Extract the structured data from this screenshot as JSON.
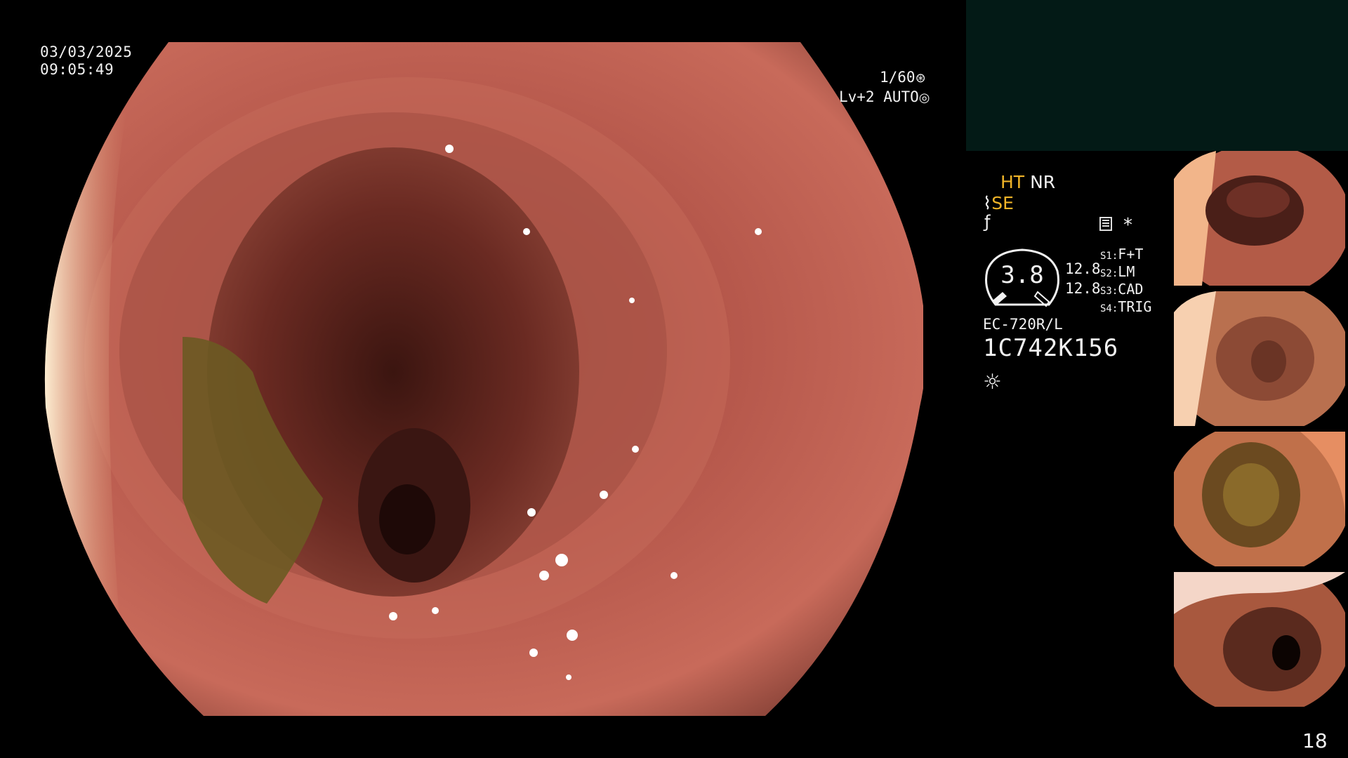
{
  "overlay": {
    "date": "03/03/2025",
    "time": "09:05:49",
    "shutter": "1/60",
    "shutter_icon": "aperture-icon",
    "level": "Lv+2 AUTO",
    "level_icon": "auto-iris-icon"
  },
  "panel": {
    "ht": "HT",
    "nr": "NR",
    "se": "SE",
    "se_icon": "scope-mode-icon",
    "f_icon": "freeze-icon",
    "grid_icon": "memory-icon",
    "star": "*",
    "gauge_value": "3.8",
    "zoom_top": "12.8",
    "zoom_bottom": "12.8",
    "switches": [
      {
        "key": "S1:",
        "value": "F+T"
      },
      {
        "key": "S2:",
        "value": "LM"
      },
      {
        "key": "S3:",
        "value": "CAD"
      },
      {
        "key": "S4:",
        "value": "TRIG"
      }
    ],
    "model": "EC-720R/L",
    "serial": "1C742K156",
    "light_icon": "sun-icon"
  },
  "thumbnails": [
    {
      "label": "thumbnail-1"
    },
    {
      "label": "thumbnail-2"
    },
    {
      "label": "thumbnail-3"
    },
    {
      "label": "thumbnail-4"
    }
  ],
  "page_number": "18",
  "colors": {
    "accent_yellow": "#f0b428",
    "tissue": "#b8574a",
    "dark_panel": "#031a16"
  }
}
